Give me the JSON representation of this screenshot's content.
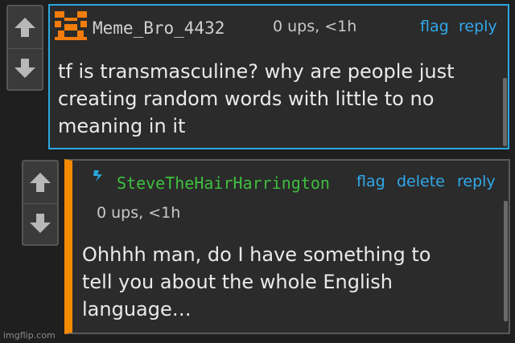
{
  "colors": {
    "background": "#1f1f1f",
    "comment_bg": "#2b2b2b",
    "highlight_border": "#29a8e0",
    "thread_accent": "#f48a00",
    "link": "#31a9ec",
    "username_1": "#d0d0d0",
    "username_2": "#3fbf3f",
    "avatar_1": "#f27d0c",
    "avatar_2": "#29a8e0"
  },
  "comments": [
    {
      "username": "Meme_Bro_4432",
      "avatar_icon": "pixel-face-icon",
      "meta": "0 ups, <1h",
      "actions": {
        "flag": "flag",
        "reply": "reply"
      },
      "body": "tf is transmasculine? why are people just\ncreating random words with little to no\nmeaning in it"
    },
    {
      "username": "SteveTheHairHarrington",
      "avatar_icon": "lightning-icon",
      "meta": "0 ups, <1h",
      "actions": {
        "flag": "flag",
        "delete": "delete",
        "reply": "reply"
      },
      "body": "Ohhhh man, do I have something to\ntell you about the whole English\nlanguage…"
    }
  ],
  "icons": {
    "upvote": "up-arrow-icon",
    "downvote": "down-arrow-icon"
  },
  "watermark": "imgflip.com"
}
